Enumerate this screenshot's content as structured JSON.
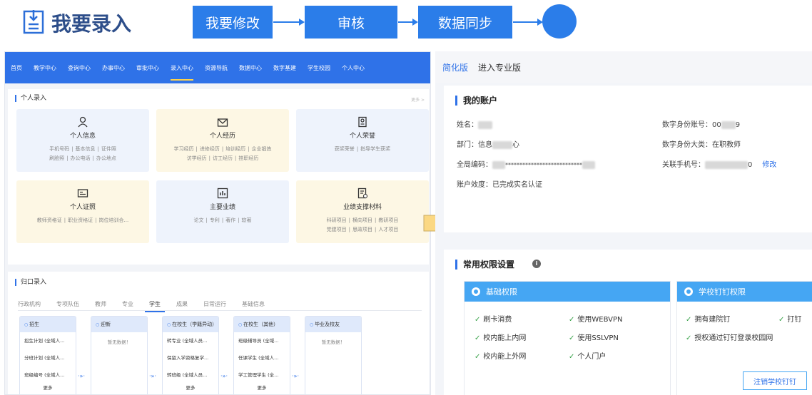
{
  "flow": {
    "title": "我要录入",
    "steps": [
      "我要修改",
      "审核",
      "数据同步"
    ]
  },
  "left": {
    "nav": [
      "首页",
      "教学中心",
      "查询中心",
      "办事中心",
      "审批中心",
      "录入中心",
      "资源导航",
      "数据中心",
      "数字基建",
      "学生校园",
      "个人中心"
    ],
    "section1": {
      "title": "个人录入",
      "more": "更多 >",
      "cards": [
        {
          "title": "个人信息",
          "links": [
            "手机号码",
            "基本信息",
            "证件照",
            "刷脸照",
            "办公电话",
            "办公地点"
          ]
        },
        {
          "title": "个人经历",
          "links": [
            "学习经历",
            "进修经历",
            "培训经历",
            "企业锻炼",
            "访学经历",
            "访工经历",
            "挂职经历"
          ]
        },
        {
          "title": "个人荣誉",
          "links": [
            "获奖荣誉",
            "指导学生获奖"
          ]
        },
        {
          "title": "个人证照",
          "links": [
            "教师资格证",
            "职业资格证",
            "岗位培训合..."
          ]
        },
        {
          "title": "主要业绩",
          "links": [
            "论文",
            "专利",
            "著作",
            "软著"
          ]
        },
        {
          "title": "业绩支撑材料",
          "links": [
            "科研项目",
            "横向项目",
            "教研项目",
            "党建项目",
            "思政项目",
            "人才项目"
          ]
        }
      ]
    },
    "section2": {
      "title": "归口录入",
      "tabs": [
        "行政机构",
        "专项队伍",
        "教师",
        "专业",
        "学生",
        "成果",
        "日常运行",
        "基础信息"
      ],
      "columns": [
        {
          "head": "招生",
          "items": [
            "招生计划 (全域人...",
            "分班计划 (全域人...",
            "班级编号 (全域人..."
          ],
          "more": "更多"
        },
        {
          "head": "迎新",
          "empty": "暂无数据！"
        },
        {
          "head": "在校生（学籍异动）",
          "items": [
            "转专业 (全域人员...",
            "保留入学资格复学...",
            "转班级 (全域人员..."
          ],
          "more": "更多"
        },
        {
          "head": "在校生（其他）",
          "items": [
            "班级辅导员 (全域...",
            "任课学生 (全域人...",
            "学工管理学生 (全..."
          ],
          "more": "更多"
        },
        {
          "head": "毕业及校友",
          "empty": "暂无数据！"
        }
      ]
    }
  },
  "right": {
    "header": {
      "simple": "简化版",
      "pro": "进入专业版"
    },
    "account": {
      "title": "我的账户",
      "name_label": "姓名：",
      "dept_label": "部门：",
      "dept_value_a": "信息",
      "dept_value_b": "心",
      "code_label": "全局编码：",
      "code_value": "***************************",
      "status_label": "账户效度：",
      "status_value": "已完成实名认证",
      "digital_id_label": "数字身份账号：",
      "digital_id_a": "00",
      "digital_id_b": "9",
      "category_label": "数字身份大类：",
      "category_value": "在职教师",
      "phone_label": "关联手机号：",
      "phone_tail": "0",
      "edit": "修改"
    },
    "permissions": {
      "title": "常用权限设置",
      "info_icon": "i",
      "basic": {
        "head": "基础权限",
        "items": [
          "刷卡消费",
          "使用WEBVPN",
          "校内能上内网",
          "使用SSLVPN",
          "校内能上外网",
          "个人门户"
        ]
      },
      "dingtalk": {
        "head": "学校钉钉权限",
        "items": [
          "拥有建院钉",
          "打钉",
          "授权通过钉钉登录校园网"
        ],
        "unbind": "注销学校钉钉"
      }
    }
  }
}
